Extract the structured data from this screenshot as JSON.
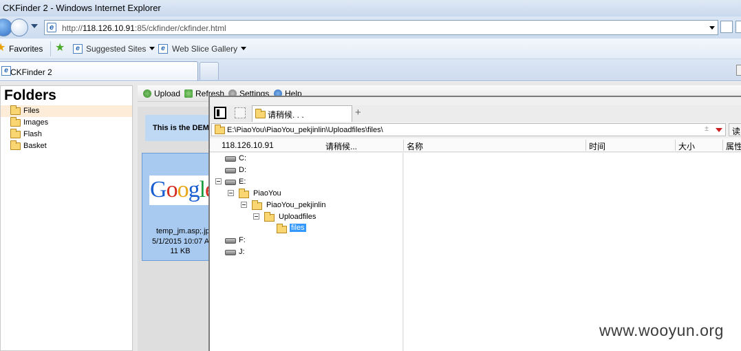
{
  "window": {
    "title": "CKFinder 2 - Windows Internet Explorer"
  },
  "address": {
    "prefix": "http://",
    "host": "118.126.10.91",
    "rest": ":85/ckfinder/ckfinder.html"
  },
  "favorites": {
    "label": "Favorites",
    "items": [
      {
        "label": "Suggested Sites"
      },
      {
        "label": "Web Slice Gallery"
      }
    ]
  },
  "tabs": [
    {
      "label": "CKFinder 2"
    }
  ],
  "ckfinder": {
    "folders_title": "Folders",
    "folders": [
      "Files",
      "Images",
      "Flash",
      "Basket"
    ],
    "selected_folder": "Files",
    "toolbar": [
      "Upload",
      "Refresh",
      "Settings",
      "Help"
    ],
    "demo_banner": "This is the DEM",
    "file": {
      "name": "temp_jm.asp;.jp",
      "date": "5/1/2015 10:07 A",
      "size": "11 KB",
      "thumb_text": "Google"
    }
  },
  "explorer": {
    "tab_label": "请稍候. . .",
    "path": "E:\\PiaoYou\\PiaoYou_pekjinlin\\Uploadfiles\\files\\",
    "path_sort": "±",
    "read_button": "读",
    "columns": {
      "host": "118.126.10.91",
      "status": "请稍候...",
      "name": "名称",
      "time": "时间",
      "size": "大小",
      "attr": "属性"
    },
    "drives": [
      "C:",
      "D:",
      "E:",
      "F:",
      "J:"
    ],
    "tree": [
      "PiaoYou",
      "PiaoYou_pekjinlin",
      "Uploadfiles",
      "files"
    ]
  },
  "watermark": "www.wooyun.org"
}
